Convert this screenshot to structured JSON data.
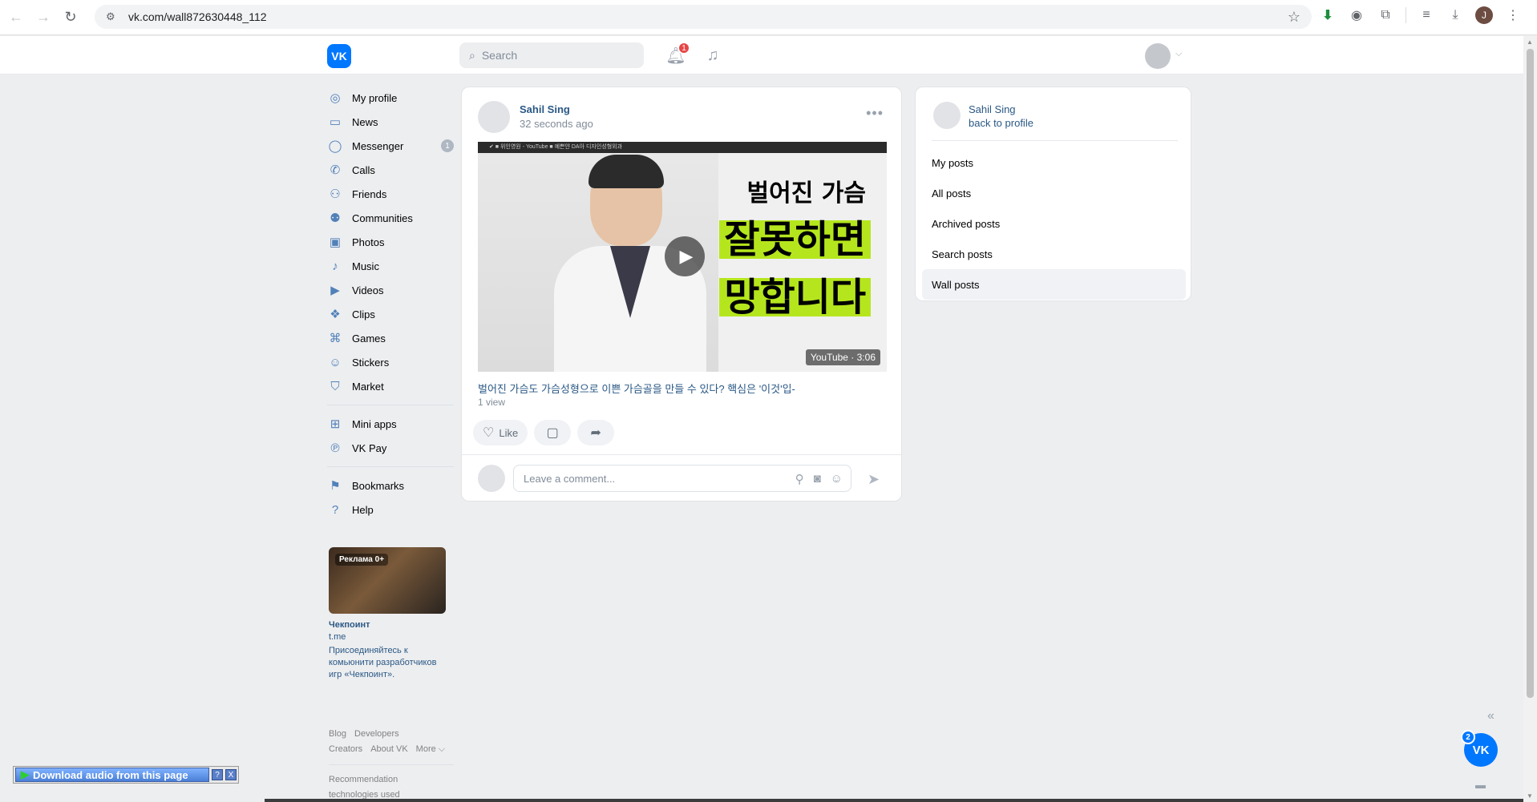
{
  "browser": {
    "url": "vk.com/wall872630448_112",
    "profile_initial": "J"
  },
  "header": {
    "logo_text": "VK",
    "search_placeholder": "Search",
    "notifications_count": "1"
  },
  "nav": {
    "items": [
      {
        "label": "My profile",
        "icon": "user-circle-icon"
      },
      {
        "label": "News",
        "icon": "news-icon"
      },
      {
        "label": "Messenger",
        "icon": "message-icon",
        "count": "1"
      },
      {
        "label": "Calls",
        "icon": "phone-icon"
      },
      {
        "label": "Friends",
        "icon": "friends-icon"
      },
      {
        "label": "Communities",
        "icon": "communities-icon"
      },
      {
        "label": "Photos",
        "icon": "photo-icon"
      },
      {
        "label": "Music",
        "icon": "music-icon"
      },
      {
        "label": "Videos",
        "icon": "video-icon"
      },
      {
        "label": "Clips",
        "icon": "clips-icon"
      },
      {
        "label": "Games",
        "icon": "gamepad-icon"
      },
      {
        "label": "Stickers",
        "icon": "sticker-icon"
      },
      {
        "label": "Market",
        "icon": "market-icon"
      }
    ],
    "items2": [
      {
        "label": "Mini apps",
        "icon": "apps-icon"
      },
      {
        "label": "VK Pay",
        "icon": "pay-icon"
      }
    ],
    "items3": [
      {
        "label": "Bookmarks",
        "icon": "bookmark-icon"
      },
      {
        "label": "Help",
        "icon": "help-icon"
      }
    ]
  },
  "ad": {
    "tag": "Реклама 0+",
    "title": "Чекпоинт",
    "domain": "t.me",
    "text": "Присоединяйтесь к комьюнити разработчиков игр «Чекпоинт»."
  },
  "footer": {
    "blog": "Blog",
    "developers": "Developers",
    "creators": "Creators",
    "about": "About VK",
    "more": "More ⌵",
    "recommendation": "Recommendation",
    "technologies": "technologies used"
  },
  "post": {
    "author": "Sahil Sing",
    "time": "32 seconds ago",
    "video": {
      "topbar": "✔  ■ 위인영원 - YouTube   ■ 예쁜얀 DA아 디자인성형외과",
      "line1": "벌어진 가슴",
      "line2": "잘못하면",
      "line3": "망합니다",
      "duration": "YouTube · 3:06",
      "title": "벌어진 가슴도 가슴성형으로 이쁜 가슴골을 만들 수 있다? 핵심은 '이것'입-",
      "views": "1 view"
    },
    "like_label": "Like",
    "comment_placeholder": "Leave a comment..."
  },
  "right_menu": {
    "name": "Sahil Sing",
    "back": "back to profile",
    "items": [
      "My posts",
      "All posts",
      "Archived posts",
      "Search posts",
      "Wall posts"
    ],
    "active_index": 4
  },
  "floating": {
    "download_audio": "Download audio from this page",
    "help": "?",
    "close": "X",
    "vk_badge": "2",
    "vk_text": "VK"
  },
  "colors": {
    "accent": "#0077ff",
    "link": "#2a5885",
    "background": "#edeef0",
    "highlight": "#b5e61d"
  }
}
